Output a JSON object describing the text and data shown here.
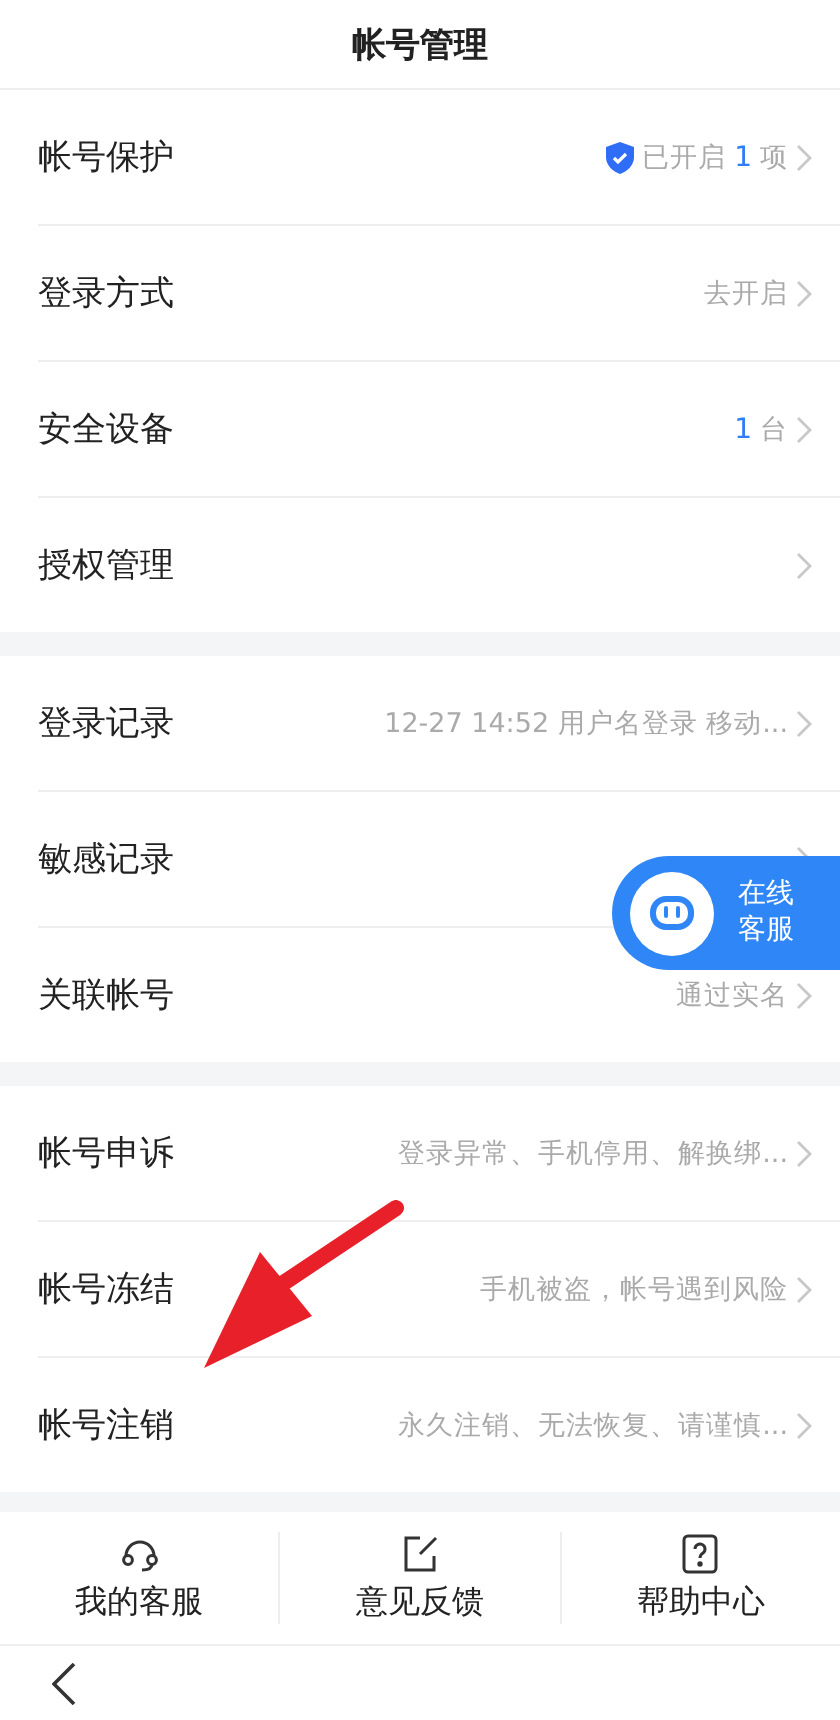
{
  "title": "帐号管理",
  "groups": [
    {
      "rows": [
        {
          "label": "帐号保护",
          "kind": "protected",
          "before": "已开启",
          "count": "1",
          "after": "项"
        },
        {
          "label": "登录方式",
          "kind": "text",
          "value": "去开启"
        },
        {
          "label": "安全设备",
          "kind": "count",
          "count": "1",
          "after": "台"
        },
        {
          "label": "授权管理",
          "kind": "none"
        }
      ]
    },
    {
      "rows": [
        {
          "label": "登录记录",
          "kind": "text",
          "value": "12-27 14:52 用户名登录 移动..."
        },
        {
          "label": "敏感记录",
          "kind": "none"
        },
        {
          "label": "关联帐号",
          "kind": "text",
          "value": "通过实名"
        }
      ]
    },
    {
      "rows": [
        {
          "label": "帐号申诉",
          "kind": "text",
          "value": "登录异常、手机停用、解换绑..."
        },
        {
          "label": "帐号冻结",
          "kind": "text",
          "value": "手机被盗，帐号遇到风险"
        },
        {
          "label": "帐号注销",
          "kind": "text",
          "value": "永久注销、无法恢复、请谨慎..."
        }
      ]
    }
  ],
  "float_button": {
    "label": "在线客服"
  },
  "footer": [
    {
      "label": "我的客服"
    },
    {
      "label": "意见反馈"
    },
    {
      "label": "帮助中心"
    }
  ]
}
